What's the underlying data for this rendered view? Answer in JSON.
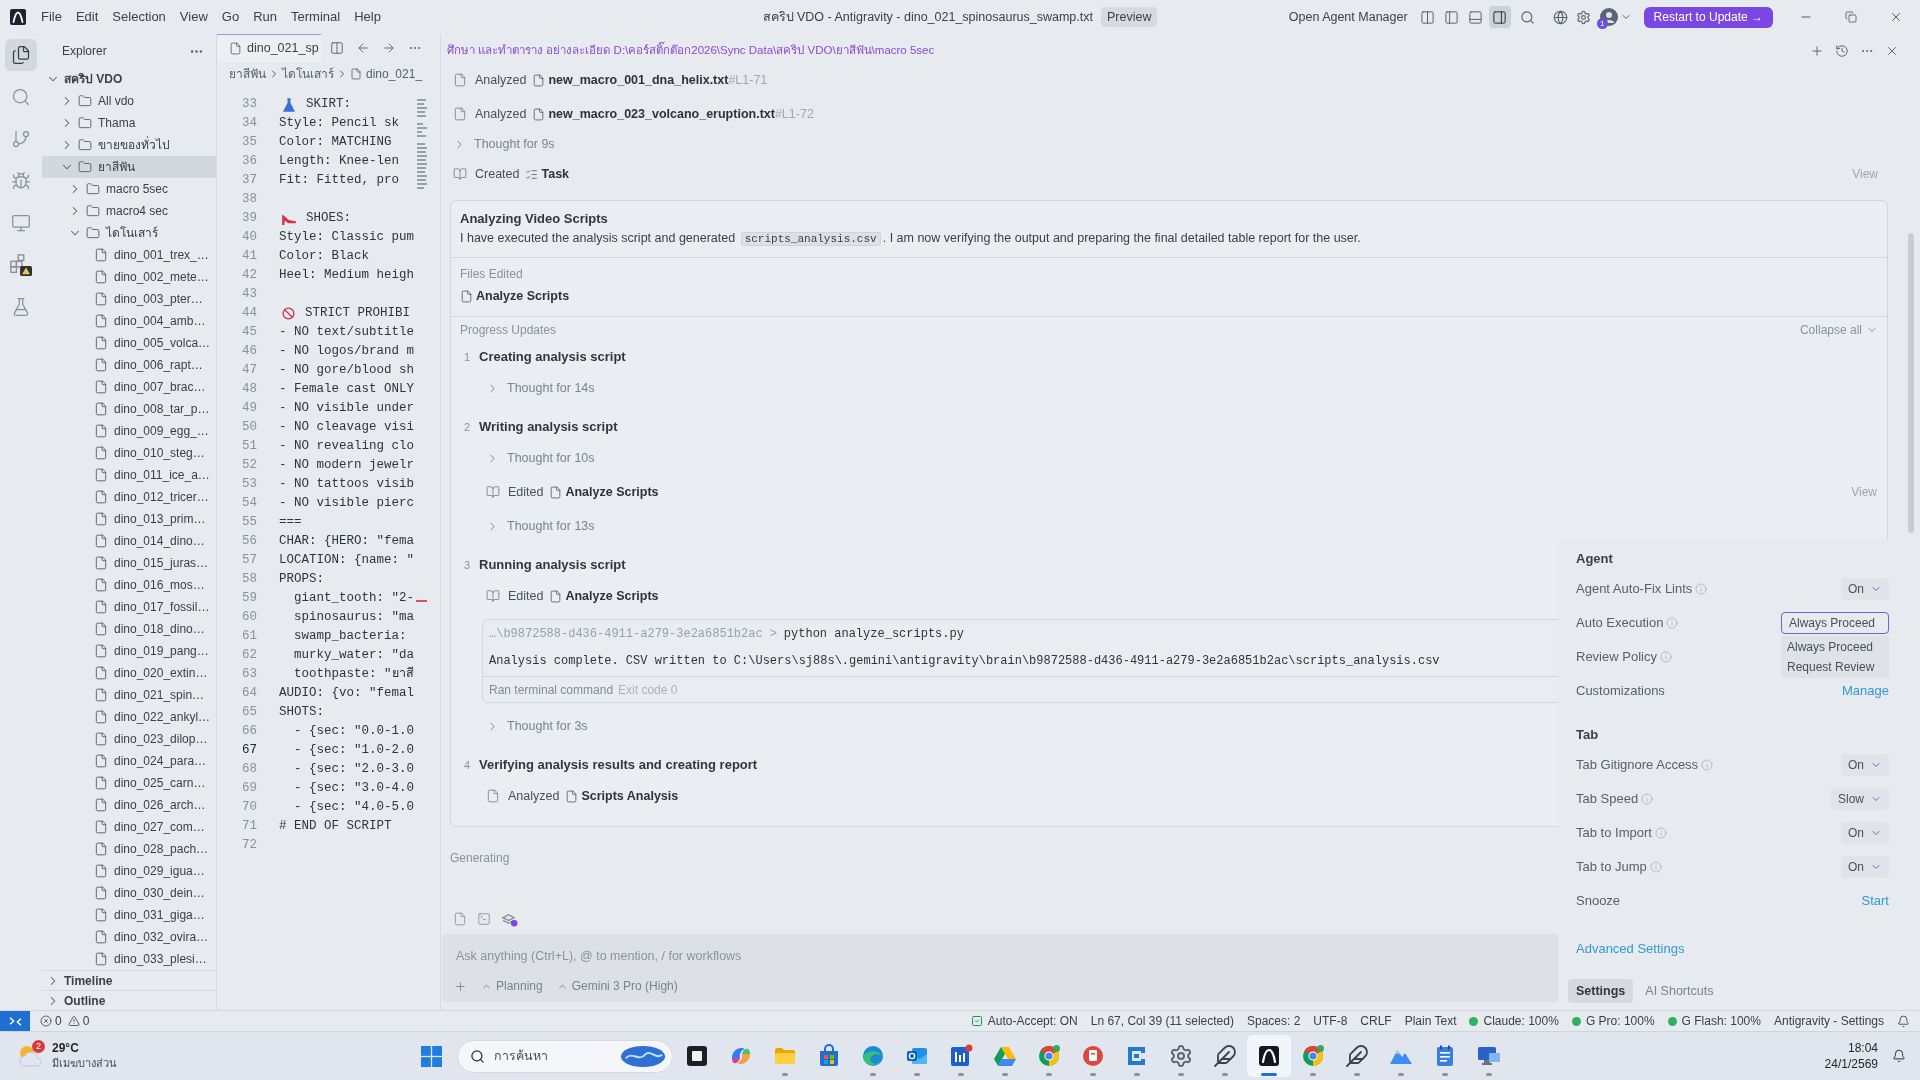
{
  "title_bar": {
    "menu": [
      "File",
      "Edit",
      "Selection",
      "View",
      "Go",
      "Run",
      "Terminal",
      "Help"
    ],
    "title": "สคริป VDO - Antigravity - dino_021_spinosaurus_swamp.txt",
    "preview": "Preview",
    "agent_manager": "Open Agent Manager",
    "layout_toggles": [
      {
        "selected": false
      },
      {
        "selected": false
      },
      {
        "selected": false
      },
      {
        "selected": true
      }
    ],
    "account_badge": "1",
    "update_button": "Restart to Update →"
  },
  "activity_bar": [
    {
      "kind": "explorer",
      "selected": true
    },
    {
      "kind": "search",
      "selected": false
    },
    {
      "kind": "scm",
      "selected": false
    },
    {
      "kind": "debug",
      "selected": false
    },
    {
      "kind": "remote",
      "selected": false
    },
    {
      "kind": "extensions",
      "selected": false
    },
    {
      "kind": "testing",
      "selected": false
    }
  ],
  "explorer": {
    "title": "Explorer",
    "tree": [
      {
        "label": "สคริป VDO",
        "kind": "root",
        "expanded": true,
        "selected": false,
        "children": [
          {
            "label": "All vdo",
            "kind": "folder",
            "expanded": false,
            "selected": false
          },
          {
            "label": "Thama",
            "kind": "folder",
            "expanded": false,
            "selected": false
          },
          {
            "label": "ขายของทั่วไป",
            "kind": "folder",
            "expanded": false,
            "selected": false
          },
          {
            "label": "ยาสีฟัน",
            "kind": "folder",
            "expanded": true,
            "selected": true,
            "children": [
              {
                "label": "macro 5sec",
                "kind": "folder",
                "expanded": false,
                "selected": false
              },
              {
                "label": "macro4 sec",
                "kind": "folder",
                "expanded": false,
                "selected": false
              },
              {
                "label": "ไดโนเสาร์",
                "kind": "folder",
                "expanded": true,
                "selected": false,
                "children": [
                  {
                    "label": "dino_001_trex_…",
                    "kind": "file",
                    "selected": false
                  },
                  {
                    "label": "dino_002_mete…",
                    "kind": "file",
                    "selected": false
                  },
                  {
                    "label": "dino_003_pter…",
                    "kind": "file",
                    "selected": false
                  },
                  {
                    "label": "dino_004_amb…",
                    "kind": "file",
                    "selected": false
                  },
                  {
                    "label": "dino_005_volca…",
                    "kind": "file",
                    "selected": false
                  },
                  {
                    "label": "dino_006_rapt…",
                    "kind": "file",
                    "selected": false
                  },
                  {
                    "label": "dino_007_brac…",
                    "kind": "file",
                    "selected": false
                  },
                  {
                    "label": "dino_008_tar_p…",
                    "kind": "file",
                    "selected": false
                  },
                  {
                    "label": "dino_009_egg_…",
                    "kind": "file",
                    "selected": false
                  },
                  {
                    "label": "dino_010_steg…",
                    "kind": "file",
                    "selected": false
                  },
                  {
                    "label": "dino_011_ice_a…",
                    "kind": "file",
                    "selected": false
                  },
                  {
                    "label": "dino_012_tricer…",
                    "kind": "file",
                    "selected": false
                  },
                  {
                    "label": "dino_013_prim…",
                    "kind": "file",
                    "selected": false
                  },
                  {
                    "label": "dino_014_dino…",
                    "kind": "file",
                    "selected": false
                  },
                  {
                    "label": "dino_015_juras…",
                    "kind": "file",
                    "selected": false
                  },
                  {
                    "label": "dino_016_mos…",
                    "kind": "file",
                    "selected": false
                  },
                  {
                    "label": "dino_017_fossil…",
                    "kind": "file",
                    "selected": false
                  },
                  {
                    "label": "dino_018_dino…",
                    "kind": "file",
                    "selected": false
                  },
                  {
                    "label": "dino_019_pang…",
                    "kind": "file",
                    "selected": false
                  },
                  {
                    "label": "dino_020_extin…",
                    "kind": "file",
                    "selected": false
                  },
                  {
                    "label": "dino_021_spin…",
                    "kind": "file",
                    "selected": false
                  },
                  {
                    "label": "dino_022_ankyl…",
                    "kind": "file",
                    "selected": false
                  },
                  {
                    "label": "dino_023_dilop…",
                    "kind": "file",
                    "selected": false
                  },
                  {
                    "label": "dino_024_para…",
                    "kind": "file",
                    "selected": false
                  },
                  {
                    "label": "dino_025_carn…",
                    "kind": "file",
                    "selected": false
                  },
                  {
                    "label": "dino_026_arch…",
                    "kind": "file",
                    "selected": false
                  },
                  {
                    "label": "dino_027_com…",
                    "kind": "file",
                    "selected": false
                  },
                  {
                    "label": "dino_028_pach…",
                    "kind": "file",
                    "selected": false
                  },
                  {
                    "label": "dino_029_igua…",
                    "kind": "file",
                    "selected": false
                  },
                  {
                    "label": "dino_030_dein…",
                    "kind": "file",
                    "selected": false
                  },
                  {
                    "label": "dino_031_giga…",
                    "kind": "file",
                    "selected": false
                  },
                  {
                    "label": "dino_032_ovira…",
                    "kind": "file",
                    "selected": false
                  },
                  {
                    "label": "dino_033_plesi…",
                    "kind": "file",
                    "selected": false
                  }
                ]
              }
            ]
          }
        ]
      }
    ],
    "sections": [
      {
        "label": "Timeline",
        "expanded": false
      },
      {
        "label": "Outline",
        "expanded": false
      }
    ]
  },
  "editor": {
    "tab": "dino_021_sp",
    "breadcrumbs": [
      "ยาสีฟัน",
      "ไดโนเสาร์",
      "dino_021_"
    ],
    "lines": [
      {
        "number": "33",
        "kind": "dress",
        "text": "SKIRT:",
        "current": false
      },
      {
        "number": "34",
        "kind": "code",
        "text": "Style: Pencil sk",
        "current": false
      },
      {
        "number": "35",
        "kind": "code",
        "text": "Color: MATCHING",
        "current": false
      },
      {
        "number": "36",
        "kind": "code",
        "text": "Length: Knee-len",
        "current": false
      },
      {
        "number": "37",
        "kind": "code",
        "text": "Fit: Fitted, pro",
        "current": false
      },
      {
        "number": "38",
        "kind": "code",
        "current": false
      },
      {
        "number": "39",
        "kind": "shoe",
        "text": "SHOES:",
        "current": false
      },
      {
        "number": "40",
        "kind": "code",
        "text": "Style: Classic pum",
        "current": false
      },
      {
        "number": "41",
        "kind": "code",
        "text": "Color: Black",
        "current": false
      },
      {
        "number": "42",
        "kind": "code",
        "text": "Heel: Medium heigh",
        "current": false
      },
      {
        "number": "43",
        "kind": "code",
        "current": false
      },
      {
        "number": "44",
        "kind": "ban",
        "text": "STRICT PROHIBI",
        "current": false
      },
      {
        "number": "45",
        "kind": "code",
        "text": "- NO text/subtitle",
        "current": false
      },
      {
        "number": "46",
        "kind": "code",
        "text": "- NO logos/brand m",
        "current": false
      },
      {
        "number": "47",
        "kind": "code",
        "text": "- NO gore/blood sh",
        "current": false
      },
      {
        "number": "48",
        "kind": "code",
        "text": "- Female cast ONLY",
        "current": false
      },
      {
        "number": "49",
        "kind": "code",
        "text": "- NO visible under",
        "current": false
      },
      {
        "number": "50",
        "kind": "code",
        "text": "- NO cleavage visi",
        "current": false
      },
      {
        "number": "51",
        "kind": "code",
        "text": "- NO revealing clo",
        "current": false
      },
      {
        "number": "52",
        "kind": "code",
        "text": "- NO modern jewelr",
        "current": false
      },
      {
        "number": "53",
        "kind": "code",
        "text": "- NO tattoos visib",
        "current": false
      },
      {
        "number": "54",
        "kind": "code",
        "text": "- NO visible pierc",
        "current": false
      },
      {
        "number": "55",
        "kind": "code",
        "text": "===",
        "current": false
      },
      {
        "number": "56",
        "kind": "code",
        "text": "CHAR: {HERO: \"fema",
        "current": false
      },
      {
        "number": "57",
        "kind": "code",
        "text": "LOCATION: {name: \"",
        "current": false
      },
      {
        "number": "58",
        "kind": "code",
        "text": "PROPS:",
        "current": false
      },
      {
        "number": "59",
        "kind": "code",
        "text": "  giant_tooth: \"2-",
        "current": false
      },
      {
        "number": "60",
        "kind": "code",
        "text": "  spinosaurus: \"ma",
        "current": false
      },
      {
        "number": "61",
        "kind": "code",
        "text": "  swamp_bacteria:",
        "current": false
      },
      {
        "number": "62",
        "kind": "code",
        "text": "  murky_water: \"da",
        "current": false
      },
      {
        "number": "63",
        "kind": "code",
        "text": "  toothpaste: \"ยาสี",
        "current": false
      },
      {
        "number": "64",
        "kind": "code",
        "text": "AUDIO: {vo: \"femal",
        "current": false
      },
      {
        "number": "65",
        "kind": "code",
        "text": "SHOTS:",
        "current": false
      },
      {
        "number": "66",
        "kind": "code",
        "text": "  - {sec: \"0.0-1.0",
        "current": false
      },
      {
        "number": "67",
        "kind": "code",
        "text": "  - {sec: \"1.0-2.0",
        "current": true
      },
      {
        "number": "68",
        "kind": "code",
        "text": "  - {sec: \"2.0-3.0",
        "current": false
      },
      {
        "number": "69",
        "kind": "code",
        "text": "  - {sec: \"3.0-4.0",
        "current": false
      },
      {
        "number": "70",
        "kind": "code",
        "text": "  - {sec: \"4.0-5.0",
        "current": false
      },
      {
        "number": "71",
        "kind": "code",
        "text": "# END OF SCRIPT",
        "current": false
      },
      {
        "number": "72",
        "kind": "code",
        "current": false
      }
    ]
  },
  "agent": {
    "path": "ศึกษา และทำตาราง อย่างละเอียด D:\\คอร์สติ๊กต๊อก2026\\Sync Data\\สคริป VDO\\ยาสีฟัน\\macro 5sec",
    "steps": [
      {
        "kind": "analyzed",
        "action": "Analyzed",
        "file": "new_macro_001_dna_helix.txt",
        "range": "#L1-71"
      },
      {
        "kind": "analyzed",
        "action": "Analyzed",
        "file": "new_macro_023_volcano_eruption.txt",
        "range": "#L1-72"
      },
      {
        "kind": "thought",
        "text": "Thought for 9s",
        "expanded": false
      },
      {
        "kind": "created",
        "action": "Created",
        "file": "Task",
        "link": "View"
      }
    ],
    "card": {
      "title": "Analyzing Video Scripts",
      "summary": [
        {
          "kind": "text",
          "text": "I have executed the analysis script and generated "
        },
        {
          "kind": "code",
          "text": "scripts_analysis.csv"
        },
        {
          "kind": "text",
          "text": ". I am now verifying the output and preparing the final detailed table report for the user."
        }
      ],
      "files_label": "Files Edited",
      "files": [
        "Analyze Scripts"
      ],
      "progress_label": "Progress Updates",
      "collapse_all": "Collapse all",
      "updates": [
        {
          "number": "1",
          "title": "Creating analysis script",
          "items": [
            {
              "kind": "thought",
              "text": "Thought for 14s",
              "expanded": false
            }
          ]
        },
        {
          "number": "2",
          "title": "Writing analysis script",
          "items": [
            {
              "kind": "thought",
              "text": "Thought for 10s",
              "expanded": false
            },
            {
              "kind": "edited",
              "action": "Edited",
              "file": "Analyze Scripts",
              "link": "View"
            },
            {
              "kind": "thought",
              "text": "Thought for 13s",
              "expanded": false
            }
          ]
        },
        {
          "number": "3",
          "title": "Running analysis script",
          "items": [
            {
              "kind": "edited",
              "action": "Edited",
              "file": "Analyze Scripts"
            },
            {
              "kind": "terminal",
              "cwd": "…\\b9872588-d436-4911-a279-3e2a6851b2ac",
              "prompt": ">",
              "command": "python analyze_scripts.py",
              "output": "Analysis complete. CSV written to C:\\Users\\sj88s\\.gemini\\antigravity\\brain\\b9872588-d436-4911-a279-3e2a6851b2ac\\scripts_analysis.csv",
              "footer": "Ran terminal command",
              "exit": "Exit code 0"
            },
            {
              "kind": "thought",
              "text": "Thought for 3s",
              "expanded": false
            }
          ]
        },
        {
          "number": "4",
          "title": "Verifying analysis results and creating report",
          "items": [
            {
              "kind": "analyzed",
              "action": "Analyzed",
              "file": "Scripts Analysis"
            }
          ]
        }
      ]
    },
    "status": "Generating",
    "composer": {
      "placeholder": "Ask anything (Ctrl+L), @ to mention, / for workflows",
      "mode": "Planning",
      "model": "Gemini 3 Pro (High)"
    }
  },
  "settings_panel": {
    "sections": [
      {
        "title": "Agent",
        "rows": [
          {
            "kind": "select",
            "label": "Agent Auto-Fix Lints",
            "info": true,
            "value": "On",
            "open": false
          },
          {
            "kind": "select",
            "label": "Auto Execution",
            "info": true,
            "value": "Always Proceed",
            "open": true,
            "options": [
              "Always Proceed",
              "Request Review"
            ]
          },
          {
            "kind": "label",
            "label": "Review Policy",
            "info": true
          },
          {
            "kind": "link",
            "label": "Customizations",
            "info": false,
            "value": "Manage"
          }
        ]
      },
      {
        "title": "Tab",
        "rows": [
          {
            "kind": "select",
            "label": "Tab Gitignore Access",
            "info": true,
            "value": "On",
            "open": false
          },
          {
            "kind": "select",
            "label": "Tab Speed",
            "info": true,
            "value": "Slow",
            "open": false
          },
          {
            "kind": "select",
            "label": "Tab to Import",
            "info": true,
            "value": "On",
            "open": false
          },
          {
            "kind": "select",
            "label": "Tab to Jump",
            "info": true,
            "value": "On",
            "open": false
          },
          {
            "kind": "link",
            "label": "Snooze",
            "info": false,
            "value": "Start"
          }
        ]
      }
    ],
    "advanced_link": "Advanced Settings",
    "tabs": [
      {
        "label": "Settings",
        "selected": true
      },
      {
        "label": "AI Shortcuts",
        "selected": false
      }
    ]
  },
  "status_bar": {
    "problems": {
      "errors": "0",
      "warnings": "0"
    },
    "items": [
      {
        "kind": "check",
        "text": "Auto-Accept: ON"
      },
      {
        "kind": "text",
        "text": "Ln 67, Col 39 (11 selected)"
      },
      {
        "kind": "text",
        "text": "Spaces: 2"
      },
      {
        "kind": "text",
        "text": "UTF-8"
      },
      {
        "kind": "text",
        "text": "CRLF"
      },
      {
        "kind": "text",
        "text": "Plain Text"
      },
      {
        "kind": "quota",
        "text": "Claude: 100%"
      },
      {
        "kind": "quota",
        "text": "G Pro: 100%"
      },
      {
        "kind": "quota",
        "text": "G Flash: 100%"
      },
      {
        "kind": "text",
        "text": "Antigravity - Settings"
      }
    ]
  },
  "taskbar": {
    "weather": {
      "badge": "2",
      "temperature": "29°C",
      "condition": "มีเมฆบางส่วน"
    },
    "search": {
      "placeholder": "การค้นหา"
    },
    "apps": [
      {
        "kind": "dark_tile",
        "running": false,
        "selected": false
      },
      {
        "kind": "swirl",
        "running": false,
        "selected": false
      },
      {
        "kind": "folder",
        "running": true,
        "selected": false
      },
      {
        "kind": "bag",
        "running": false,
        "selected": false
      },
      {
        "kind": "wave_circle",
        "running": true,
        "selected": false
      },
      {
        "kind": "mail",
        "running": true,
        "selected": false
      },
      {
        "kind": "chart_tile",
        "running": true,
        "selected": false
      },
      {
        "kind": "triangle",
        "running": true,
        "selected": false
      },
      {
        "kind": "ring",
        "running": true,
        "selected": false
      },
      {
        "kind": "red_circle",
        "running": true,
        "selected": false
      },
      {
        "kind": "bracket_tile",
        "running": true,
        "selected": false
      },
      {
        "kind": "gear",
        "running": true,
        "selected": false
      },
      {
        "kind": "feather",
        "running": true,
        "selected": false
      },
      {
        "kind": "arch_tile",
        "running": true,
        "selected": true
      },
      {
        "kind": "ring",
        "running": true,
        "selected": false
      },
      {
        "kind": "feather",
        "running": true,
        "selected": false
      },
      {
        "kind": "mountain",
        "running": true,
        "selected": false
      },
      {
        "kind": "notepad",
        "running": true,
        "selected": false
      },
      {
        "kind": "monitor",
        "running": true,
        "selected": false
      }
    ],
    "clock": {
      "time": "18:04",
      "date": "24/1/2569"
    }
  }
}
